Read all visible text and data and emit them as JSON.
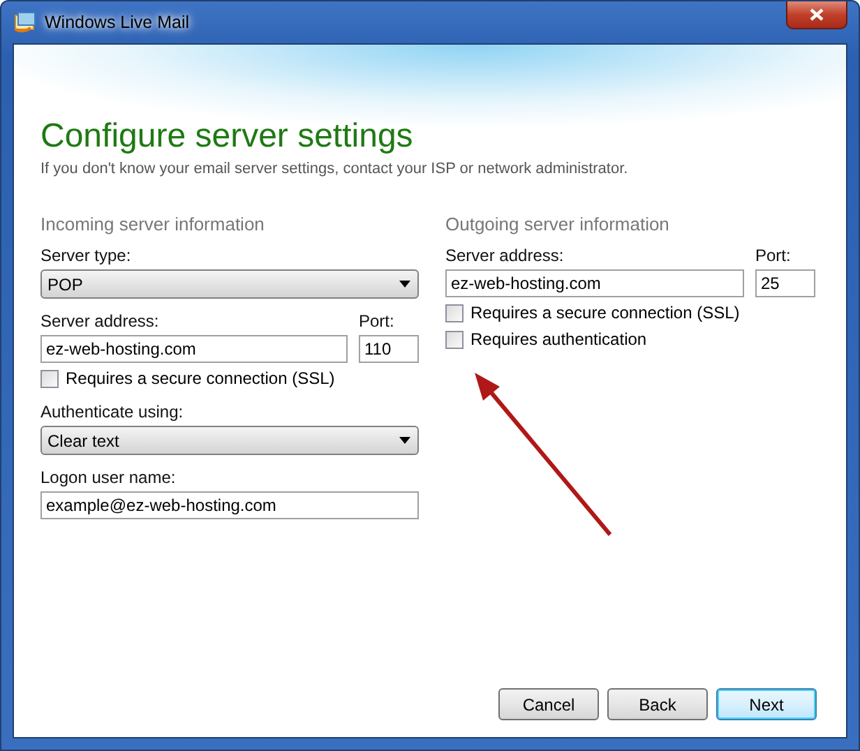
{
  "window": {
    "title": "Windows Live Mail"
  },
  "heading": "Configure server settings",
  "subtitle": "If you don't know your email server settings, contact your ISP or network administrator.",
  "incoming": {
    "title": "Incoming server information",
    "server_type_label": "Server type:",
    "server_type": "POP",
    "address_label": "Server address:",
    "address": "ez-web-hosting.com",
    "port_label": "Port:",
    "port": "110",
    "ssl": {
      "label": "Requires a secure connection (SSL)",
      "checked": false
    },
    "auth_label": "Authenticate using:",
    "auth": "Clear text",
    "logon_label": "Logon user name:",
    "logon": "example@ez-web-hosting.com"
  },
  "outgoing": {
    "title": "Outgoing server information",
    "address_label": "Server address:",
    "address": "ez-web-hosting.com",
    "port_label": "Port:",
    "port": "25",
    "checkboxes": [
      {
        "label": "Requires a secure connection (SSL)",
        "checked": false
      },
      {
        "label": "Requires authentication",
        "checked": false
      }
    ]
  },
  "buttons": [
    {
      "label": "Cancel",
      "default": false
    },
    {
      "label": "Back",
      "default": false
    },
    {
      "label": "Next",
      "default": true
    }
  ]
}
